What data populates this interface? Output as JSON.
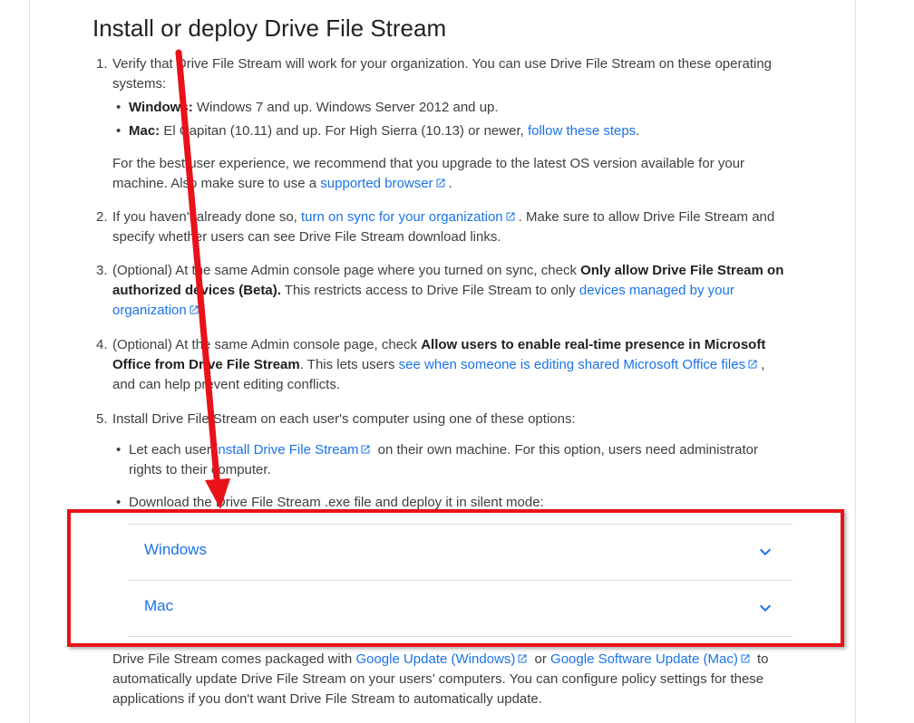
{
  "title": "Install or deploy Drive File Stream",
  "steps": {
    "s1": {
      "num": "1.",
      "line1": "Verify that Drive File Stream will work for your organization. You can use Drive File Stream on these operating",
      "line2": "systems:",
      "win_label": "Windows:",
      "win_text": " Windows 7 and up. Windows Server 2012 and up.",
      "mac_label": "Mac:",
      "mac_text": " El Capitan (10.11) and up. For High Sierra (10.13) or newer, ",
      "mac_link": "follow these steps",
      "mac_end": ".",
      "para1": "For the best user experience, we recommend that you upgrade to the latest OS version available for your",
      "para2": "machine. Also make sure to use a ",
      "para_link": "supported browser",
      "para_end": "."
    },
    "s2": {
      "num": "2.",
      "pre": "If you haven't already done so, ",
      "link": "turn on sync for your organization",
      "post": ". Make sure to allow Drive File Stream and",
      "line2": "specify whether users can see Drive File Stream download links."
    },
    "s3": {
      "num": "3.",
      "pre": "(Optional) At the same Admin console page where you turned on sync, check ",
      "bold1": "Only allow Drive File Stream on",
      "bold2": "authorized devices (Beta).",
      "mid": " This restricts access to Drive File Stream to only ",
      "link1": "devices managed by your",
      "link2": "organization",
      "end": "."
    },
    "s4": {
      "num": "4.",
      "pre": "(Optional) At the same Admin console page, check ",
      "bold1": "Allow users to enable real-time presence in Microsoft",
      "bold2": "Office from Drive File Stream",
      "mid": ". This lets users ",
      "link": "see when someone is editing shared Microsoft Office files",
      "end": ",",
      "line3": "and can help prevent editing conflicts."
    },
    "s5": {
      "num": "5.",
      "text": "Install Drive File Stream on each user's computer using one of these options:",
      "b1_pre": "Let each user ",
      "b1_link": "install Drive File Stream",
      "b1_post": " on their own machine. For this option, users need administrator",
      "b1_line2": "rights to their computer.",
      "b2": "Download the Drive File Stream .exe file and deploy it in silent mode:"
    }
  },
  "accordion": [
    {
      "label": "Windows"
    },
    {
      "label": "Mac"
    }
  ],
  "footer": {
    "pre": "Drive File Stream comes packaged with ",
    "link1": "Google Update (Windows)",
    "mid": " or ",
    "link2": "Google Software Update (Mac)",
    "post": " to",
    "line2": "automatically update Drive File Stream on your users’ computers. You can configure policy settings for these",
    "line3": "applications if you don't want Drive File Stream to automatically update."
  },
  "bullet": "•",
  "colors": {
    "link": "#1a73e8",
    "annotation": "#e8121a",
    "text": "#3c4043"
  },
  "icons": {
    "external": "open-in-new-icon",
    "chevron": "chevron-down-icon"
  }
}
